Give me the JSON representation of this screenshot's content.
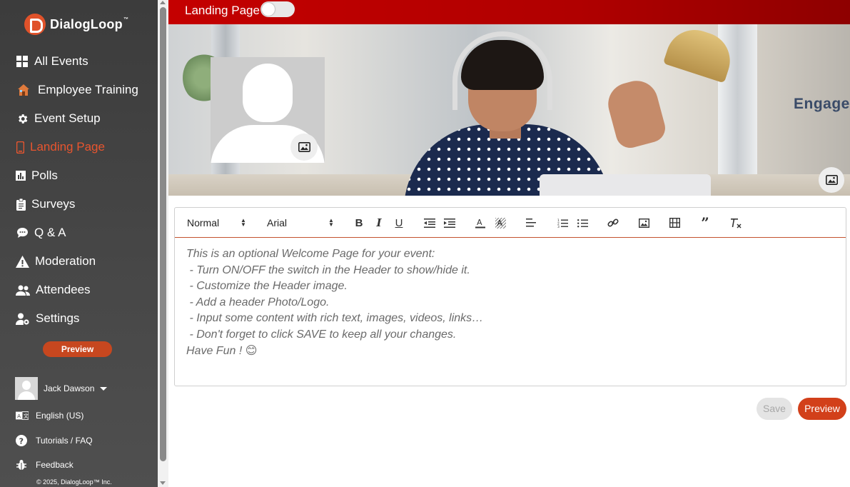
{
  "app": {
    "brand": "DialogLoop",
    "brand_tm": "™"
  },
  "sidebar": {
    "items": [
      {
        "label": "All Events",
        "icon": "grid-icon"
      },
      {
        "label": "Employee Training",
        "icon": "house-icon"
      },
      {
        "label": "Event Setup",
        "icon": "gear-icon"
      },
      {
        "label": "Landing Page",
        "icon": "phone-icon",
        "active": true
      },
      {
        "label": "Polls",
        "icon": "bar-chart-icon"
      },
      {
        "label": "Surveys",
        "icon": "clipboard-icon"
      },
      {
        "label": "Q & A",
        "icon": "chat-icon"
      },
      {
        "label": "Moderation",
        "icon": "warning-icon"
      },
      {
        "label": "Attendees",
        "icon": "users-icon"
      },
      {
        "label": "Settings",
        "icon": "user-gear-icon"
      }
    ],
    "preview_label": "Preview",
    "user_name": "Jack Dawson",
    "language": "English (US)",
    "tutorials": "Tutorials / FAQ",
    "feedback": "Feedback",
    "copyright": "© 2025, DialogLoop™ Inc."
  },
  "header": {
    "title": "Landing Page",
    "toggle_on": false
  },
  "hero": {
    "overlay_text": "Engage"
  },
  "editor": {
    "style_select": "Normal",
    "font_select": "Arial",
    "lines": [
      "This is an optional Welcome Page for your event:",
      " - Turn ON/OFF the switch in the Header to show/hide it.",
      " - Customize the Header image.",
      " - Add a header Photo/Logo.",
      " - Input some content with rich text, images, videos, links…",
      " - Don't forget to click SAVE to keep all your changes.",
      "Have Fun ! 😊"
    ]
  },
  "actions": {
    "save_label": "Save",
    "preview_label": "Preview"
  },
  "colors": {
    "accent": "#d2401a",
    "header_red": "#c40000",
    "active_nav": "#e8552f"
  }
}
